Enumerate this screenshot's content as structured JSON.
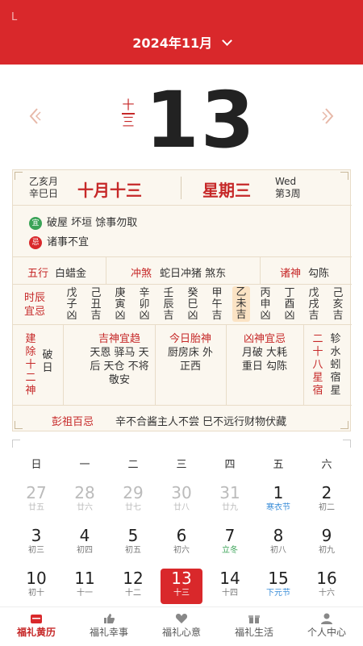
{
  "header": {
    "status_mark": "L",
    "month": "2024年11月"
  },
  "hero": {
    "lunar_day_vertical": [
      "十",
      "三"
    ],
    "day": "13"
  },
  "almanac": {
    "ganzhi": [
      "乙亥月",
      "辛巳日"
    ],
    "lunar_date": "十月十三",
    "weekday": "星期三",
    "weekday_en": "Wed",
    "week_no": "第3周",
    "yi_badge": "宜",
    "yi": "破屋 坏垣 馀事勿取",
    "ji_badge": "忌",
    "ji": "诸事不宜",
    "wuxing_label": "五行",
    "wuxing": "白蜡金",
    "chongsha_label": "冲煞",
    "chongsha": "蛇日冲猪 煞东",
    "zhushen_label": "诸神",
    "zhushen": "勾陈",
    "shichen_label": [
      "时辰",
      "宜忌"
    ],
    "shichen": [
      {
        "gz": "戊子",
        "v": "凶"
      },
      {
        "gz": "己丑",
        "v": "吉"
      },
      {
        "gz": "庚寅",
        "v": "凶"
      },
      {
        "gz": "辛卯",
        "v": "凶"
      },
      {
        "gz": "壬辰",
        "v": "吉"
      },
      {
        "gz": "癸巳",
        "v": "凶"
      },
      {
        "gz": "甲午",
        "v": "吉"
      },
      {
        "gz": "乙未",
        "v": "吉"
      },
      {
        "gz": "丙申",
        "v": "凶"
      },
      {
        "gz": "丁酉",
        "v": "凶"
      },
      {
        "gz": "戊戌",
        "v": "吉"
      },
      {
        "gz": "己亥",
        "v": "吉"
      }
    ],
    "jianchu_label": "建除十二神",
    "jianchu": "破日",
    "jishen_title": "吉神宜趋",
    "jishen": [
      "天恩 驿马 天",
      "后 天仓 不将",
      "敬安"
    ],
    "taishen_title": "今日胎神",
    "taishen": [
      "厨房床 外",
      "正西"
    ],
    "xiongshen_title": "凶神宜忌",
    "xiongshen": [
      "月破 大耗",
      "重日 勾陈"
    ],
    "xiu_label": "二十八星宿",
    "xiu": "轸水蚓宿星",
    "pengzu_label": "彭祖百忌",
    "pengzu": "辛不合酱主人不尝 巳不远行财物伏藏"
  },
  "calendar": {
    "weekdays": [
      "日",
      "一",
      "二",
      "三",
      "四",
      "五",
      "六"
    ],
    "rows": [
      [
        {
          "n": "27",
          "s": "廿五",
          "dim": true
        },
        {
          "n": "28",
          "s": "廿六",
          "dim": true
        },
        {
          "n": "29",
          "s": "廿七",
          "dim": true
        },
        {
          "n": "30",
          "s": "廿八",
          "dim": true
        },
        {
          "n": "31",
          "s": "廿九",
          "dim": true
        },
        {
          "n": "1",
          "s": "寒衣节",
          "c": "blue"
        },
        {
          "n": "2",
          "s": "初二"
        }
      ],
      [
        {
          "n": "3",
          "s": "初三"
        },
        {
          "n": "4",
          "s": "初四"
        },
        {
          "n": "5",
          "s": "初五"
        },
        {
          "n": "6",
          "s": "初六"
        },
        {
          "n": "7",
          "s": "立冬",
          "c": "green"
        },
        {
          "n": "8",
          "s": "初八"
        },
        {
          "n": "9",
          "s": "初九"
        }
      ],
      [
        {
          "n": "10",
          "s": "初十"
        },
        {
          "n": "11",
          "s": "十一"
        },
        {
          "n": "12",
          "s": "十二"
        },
        {
          "n": "13",
          "s": "十三",
          "today": true
        },
        {
          "n": "14",
          "s": "十四"
        },
        {
          "n": "15",
          "s": "下元节",
          "c": "blue"
        },
        {
          "n": "16",
          "s": "十六"
        }
      ]
    ]
  },
  "tabbar": {
    "tabs": [
      {
        "label": "福礼黄历",
        "icon": "calendar-icon",
        "active": true
      },
      {
        "label": "福礼幸事",
        "icon": "thumbs-up-icon"
      },
      {
        "label": "福礼心意",
        "icon": "heart-icon"
      },
      {
        "label": "福礼生活",
        "icon": "gift-icon"
      },
      {
        "label": "个人中心",
        "icon": "user-icon"
      }
    ]
  },
  "colors": {
    "accent": "#d9282b",
    "paper": "#fbf7ef",
    "good": "#3aa357",
    "festival": "#3a8dd8"
  }
}
